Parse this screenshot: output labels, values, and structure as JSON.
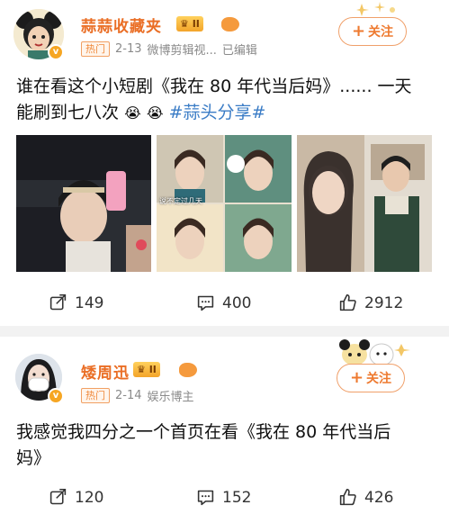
{
  "posts": [
    {
      "username": "蒜蒜收藏夹",
      "level": "II",
      "tag": "热门",
      "date": "2-13",
      "source": "微博剪辑视...",
      "edited": "已编辑",
      "follow_label": "关注",
      "content_line1": "谁在看这个小短剧《我在 80 年代当后妈》...... 一天",
      "content_line2_prefix": "能刷到七八次",
      "emoji1": "😭",
      "emoji2": "😭",
      "topic": "#蒜头分享#",
      "image_caption": "说不定过几天",
      "counts": {
        "share": "149",
        "comment": "400",
        "like": "2912"
      }
    },
    {
      "username": "矮周迅",
      "level": "II",
      "tag": "热门",
      "date": "2-14",
      "source": "娱乐博主",
      "follow_label": "关注",
      "content_line1": "我感觉我四分之一个首页在看《我在 80 年代当后",
      "content_line2": "妈》",
      "counts": {
        "share": "120",
        "comment": "152",
        "like": "426"
      }
    }
  ],
  "colors": {
    "accent": "#ea6e25",
    "topic": "#3a7cc6",
    "separator": "#f2f2f2"
  },
  "icons": [
    "share-icon",
    "comment-icon",
    "like-icon",
    "vip-badge-icon",
    "verified-badge-icon"
  ]
}
